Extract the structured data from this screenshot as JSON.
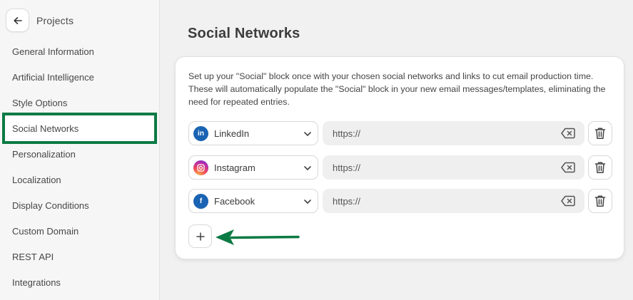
{
  "sidebar": {
    "title": "Projects",
    "items": [
      {
        "label": "General Information"
      },
      {
        "label": "Artificial Intelligence"
      },
      {
        "label": "Style Options"
      },
      {
        "label": "Social Networks"
      },
      {
        "label": "Personalization"
      },
      {
        "label": "Localization"
      },
      {
        "label": "Display Conditions"
      },
      {
        "label": "Custom Domain"
      },
      {
        "label": "REST API"
      },
      {
        "label": "Integrations"
      }
    ],
    "active_index": 3
  },
  "main": {
    "title": "Social Networks",
    "description": "Set up your \"Social\" block once with your chosen social networks and links to cut email production time. These will automatically populate the \"Social\" block in your new email messages/templates, eliminating the need for repeated entries.",
    "networks": [
      {
        "name": "LinkedIn",
        "icon": "linkedin-icon",
        "url_value": "https://"
      },
      {
        "name": "Instagram",
        "icon": "instagram-icon",
        "url_value": "https://"
      },
      {
        "name": "Facebook",
        "icon": "facebook-icon",
        "url_value": "https://"
      }
    ]
  },
  "colors": {
    "highlight": "#0c7a44",
    "brand_blue": "#1a63b3"
  }
}
